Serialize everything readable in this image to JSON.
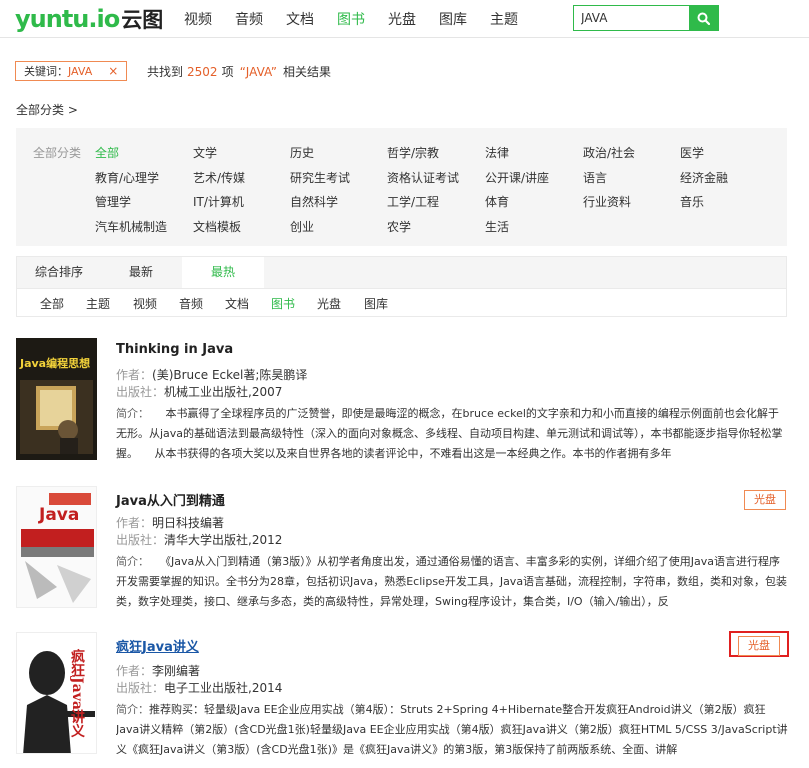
{
  "header": {
    "logo_main": "yuntu",
    "logo_io": ".io",
    "logo_cn": "云图",
    "nav": [
      "视频",
      "音频",
      "文档",
      "图书",
      "光盘",
      "图库",
      "主题"
    ],
    "active_nav": "图书",
    "search_value": "JAVA",
    "search_icon": "search-icon"
  },
  "filter": {
    "keyword_label": "关键词：",
    "keyword_value": "JAVA",
    "remove": "×",
    "found_prefix": "共找到",
    "found_count": "2502",
    "found_unit": "项",
    "found_query": "“JAVA”",
    "found_suffix": "相关结果",
    "all_categories": "全部分类  >"
  },
  "categories": {
    "label": "全部分类",
    "items": [
      "全部",
      "文学",
      "历史",
      "哲学/宗教",
      "法律",
      "政治/社会",
      "医学",
      "教育/心理学",
      "艺术/传媒",
      "研究生考试",
      "资格认证考试",
      "公开课/讲座",
      "语言",
      "经济金融",
      "管理学",
      "IT/计算机",
      "自然科学",
      "工学/工程",
      "体育",
      "行业资料",
      "音乐",
      "汽车机械制造",
      "文档模板",
      "创业",
      "农学",
      "生活"
    ]
  },
  "sort_tabs": [
    "综合排序",
    "最新",
    "最热"
  ],
  "type_tabs": [
    "全部",
    "主题",
    "视频",
    "音频",
    "文档",
    "图书",
    "光盘",
    "图库"
  ],
  "colors": {
    "accent": "#2fba4a",
    "highlight": "#e4602a",
    "link": "#1a57a6"
  },
  "results": [
    {
      "title": "Thinking in Java",
      "author_label": "作者：",
      "author": "(美)Bruce Eckel著;陈昊鹏译",
      "publisher_label": "出版社：",
      "publisher": "机械工业出版社,2007",
      "intro_label": "简介：",
      "intro": "本书赢得了全球程序员的广泛赞誉，即使是最晦涩的概念，在bruce eckel的文字亲和力和小而直接的编程示例面前也会化解于无形。从java的基础语法到最高级特性（深入的面向对象概念、多线程、自动项目构建、单元测试和调试等），本书都能逐步指导你轻松掌握。　　从本书获得的各项大奖以及来自世界各地的读者评论中，不难看出这是一本经典之作。本书的作者拥有多年",
      "badge": "",
      "cover_title": "Java编程思想"
    },
    {
      "title": "Java从入门到精通",
      "author_label": "作者：",
      "author": "明日科技编著",
      "publisher_label": "出版社：",
      "publisher": "清华大学出版社,2012",
      "intro_label": "简介：",
      "intro": "《Java从入门到精通（第3版）》从初学者角度出发，通过通俗易懂的语言、丰富多彩的实例，详细介绍了使用Java语言进行程序开发需要掌握的知识。全书分为28章，包括初识Java，熟悉Eclipse开发工具，Java语言基础，流程控制，字符串，数组，类和对象，包装类，数字处理类，接口、继承与多态，类的高级特性，异常处理，Swing程序设计，集合类，I/O（输入/输出），反",
      "badge": "光盘",
      "cover_title": "Java"
    },
    {
      "title": "疯狂Java讲义",
      "author_label": "作者：",
      "author": "李刚编著",
      "publisher_label": "出版社：",
      "publisher": "电子工业出版社,2014",
      "intro_label": "简介：",
      "intro": "推荐购买：轻量级Java EE企业应用实战（第4版）：Struts 2+Spring 4+Hibernate整合开发疯狂Android讲义（第2版）疯狂Java讲义精粹（第2版）(含CD光盘1张)轻量级Java EE企业应用实战（第4版）疯狂Java讲义（第2版）疯狂HTML 5/CSS 3/JavaScript讲义《疯狂Java讲义（第3版）(含CD光盘1张)》是《疯狂Java讲义》的第3版，第3版保持了前两版系统、全面、讲解",
      "badge": "光盘",
      "cover_title": "疯狂Java讲义"
    }
  ]
}
